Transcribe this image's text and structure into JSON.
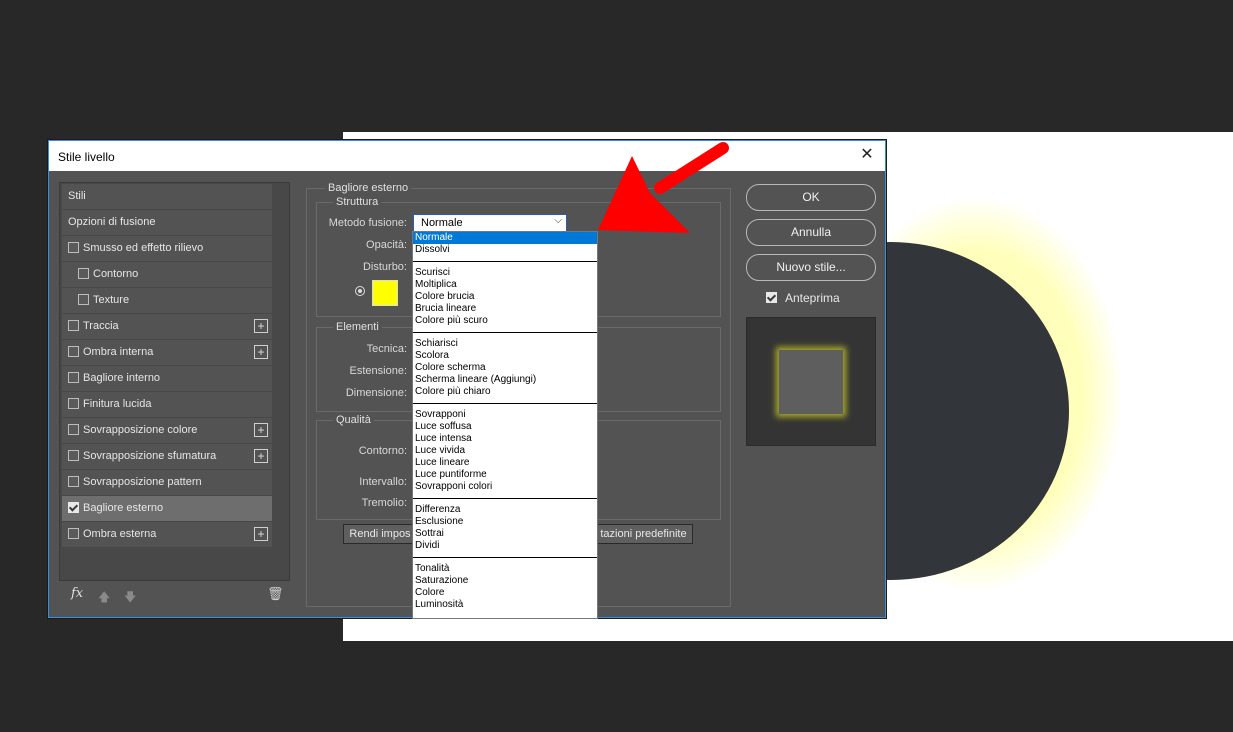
{
  "dialog": {
    "title": "Stile livello",
    "close_glyph": "✕"
  },
  "left_panel": {
    "items": [
      {
        "label": "Stili",
        "checkbox": false,
        "checked": false,
        "indent": false,
        "plus": false,
        "selected": false
      },
      {
        "label": "Opzioni di fusione",
        "checkbox": false,
        "checked": false,
        "indent": false,
        "plus": false,
        "selected": false
      },
      {
        "label": "Smusso ed effetto rilievo",
        "checkbox": true,
        "checked": false,
        "indent": false,
        "plus": false,
        "selected": false
      },
      {
        "label": "Contorno",
        "checkbox": true,
        "checked": false,
        "indent": true,
        "plus": false,
        "selected": false
      },
      {
        "label": "Texture",
        "checkbox": true,
        "checked": false,
        "indent": true,
        "plus": false,
        "selected": false
      },
      {
        "label": "Traccia",
        "checkbox": true,
        "checked": false,
        "indent": false,
        "plus": true,
        "selected": false
      },
      {
        "label": "Ombra interna",
        "checkbox": true,
        "checked": false,
        "indent": false,
        "plus": true,
        "selected": false
      },
      {
        "label": "Bagliore interno",
        "checkbox": true,
        "checked": false,
        "indent": false,
        "plus": false,
        "selected": false
      },
      {
        "label": "Finitura lucida",
        "checkbox": true,
        "checked": false,
        "indent": false,
        "plus": false,
        "selected": false
      },
      {
        "label": "Sovrapposizione colore",
        "checkbox": true,
        "checked": false,
        "indent": false,
        "plus": true,
        "selected": false
      },
      {
        "label": "Sovrapposizione sfumatura",
        "checkbox": true,
        "checked": false,
        "indent": false,
        "plus": true,
        "selected": false
      },
      {
        "label": "Sovrapposizione pattern",
        "checkbox": true,
        "checked": false,
        "indent": false,
        "plus": false,
        "selected": false
      },
      {
        "label": "Bagliore esterno",
        "checkbox": true,
        "checked": true,
        "indent": false,
        "plus": false,
        "selected": true
      },
      {
        "label": "Ombra esterna",
        "checkbox": true,
        "checked": false,
        "indent": false,
        "plus": true,
        "selected": false
      }
    ],
    "footer": {
      "fx_label": "fx",
      "plus_glyph": "+",
      "up_glyph": "🡅",
      "down_glyph": "🡇",
      "trash_glyph": "🗑"
    }
  },
  "effect_panel": {
    "title": "Bagliore esterno",
    "structure": {
      "label": "Struttura",
      "blend_mode_label": "Metodo fusione:",
      "blend_mode_value": "Normale",
      "opacity_label": "Opacità:",
      "noise_label": "Disturbo:",
      "glow_color": "#ffff00"
    },
    "elements": {
      "label": "Elementi",
      "technique_label": "Tecnica:",
      "spread_label": "Estensione:",
      "size_label": "Dimensione:"
    },
    "quality": {
      "label": "Qualità",
      "contour_label": "Contorno:",
      "range_label": "Intervallo:",
      "jitter_label": "Tremolio:"
    },
    "make_default_label": "Rendi impos",
    "reset_default_label": "tazioni predefinite"
  },
  "right_panel": {
    "ok_label": "OK",
    "cancel_label": "Annulla",
    "new_style_label": "Nuovo stile...",
    "preview_label": "Anteprima",
    "preview_checked": true
  },
  "blend_dropdown": {
    "groups": [
      [
        "Normale",
        "Dissolvi"
      ],
      [
        "Scurisci",
        "Moltiplica",
        "Colore brucia",
        "Brucia lineare",
        "Colore più scuro"
      ],
      [
        "Schiarisci",
        "Scolora",
        "Colore scherma",
        "Scherma lineare (Aggiungi)",
        "Colore più chiaro"
      ],
      [
        "Sovrapponi",
        "Luce soffusa",
        "Luce intensa",
        "Luce vivida",
        "Luce lineare",
        "Luce puntiforme",
        "Sovrapponi colori"
      ],
      [
        "Differenza",
        "Esclusione",
        "Sottrai",
        "Dividi"
      ],
      [
        "Tonalità",
        "Saturazione",
        "Colore",
        "Luminosità"
      ]
    ],
    "highlighted": "Normale"
  },
  "colors": {
    "accent": "#0078d7",
    "annotation_arrow": "#ff0000",
    "glow": "#ffff00"
  }
}
